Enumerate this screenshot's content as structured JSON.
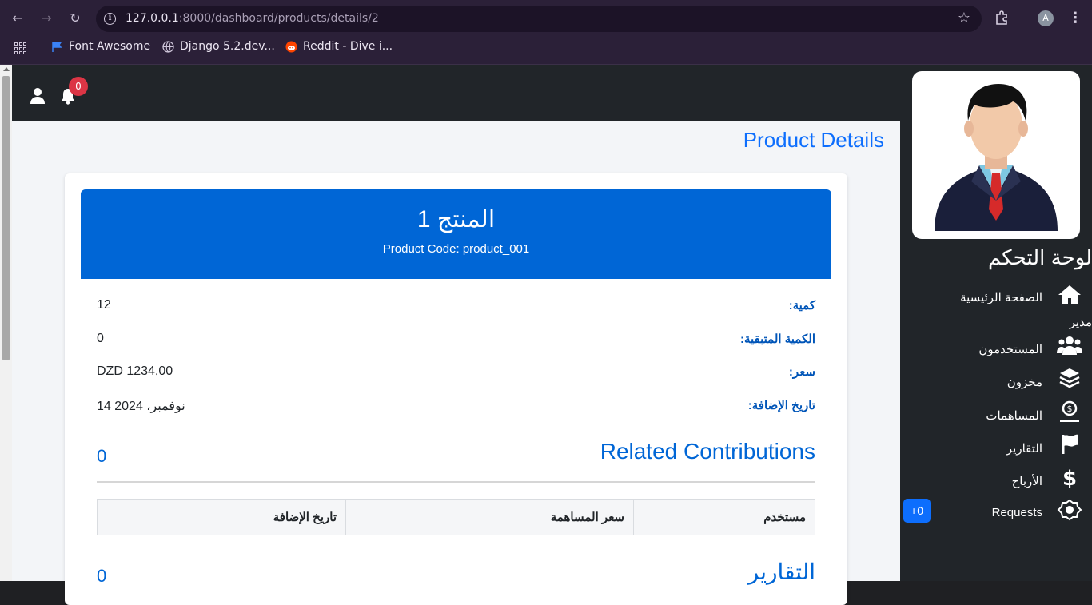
{
  "browser": {
    "url_host": "127.0.0.1",
    "url_rest": ":8000/dashboard/products/details/2",
    "profile_initial": "A",
    "bookmarks": [
      {
        "label": "Font Awesome",
        "icon": "flag-icon"
      },
      {
        "label": "Django 5.2.dev...",
        "icon": "globe-icon"
      },
      {
        "label": "Reddit - Dive i...",
        "icon": "reddit-icon"
      }
    ]
  },
  "topbar": {
    "notification_count": "0"
  },
  "page": {
    "title": "Product Details",
    "product_name": "المنتج 1",
    "product_code": "Product Code: product_001",
    "fields": [
      {
        "label": "كمية:",
        "value": "12"
      },
      {
        "label": "الكمية المتبقية:",
        "value": "0"
      },
      {
        "label": "سعر:",
        "value": "DZD 1234,00"
      },
      {
        "label": "تاريخ الإضافة:",
        "value": "14 نوفمبر، 2024"
      }
    ],
    "contributions": {
      "title": "Related Contributions",
      "count": "0",
      "columns": [
        "مستخدم",
        "سعر المساهمة",
        "تاريخ الإضافة"
      ]
    },
    "reports": {
      "title": "التقارير",
      "count": "0"
    }
  },
  "sidebar": {
    "title": "لوحة التحكم",
    "manager_label": "مدير",
    "items": [
      {
        "label": "الصفحة الرئيسية",
        "icon": "home-icon"
      },
      {
        "label": "المستخدمون",
        "icon": "users-icon"
      },
      {
        "label": "مخزون",
        "icon": "layers-icon"
      },
      {
        "label": "المساهمات",
        "icon": "contribution-icon"
      },
      {
        "label": "التقارير",
        "icon": "flag-icon"
      },
      {
        "label": "الأرباح",
        "icon": "dollar-icon"
      },
      {
        "label": "Requests",
        "icon": "badge-icon"
      }
    ],
    "requests_badge": "+0"
  },
  "colors": {
    "accent": "#0d6efd",
    "card_header": "#0066d6",
    "sidebar_bg": "#212529",
    "badge_red": "#dc3545"
  }
}
